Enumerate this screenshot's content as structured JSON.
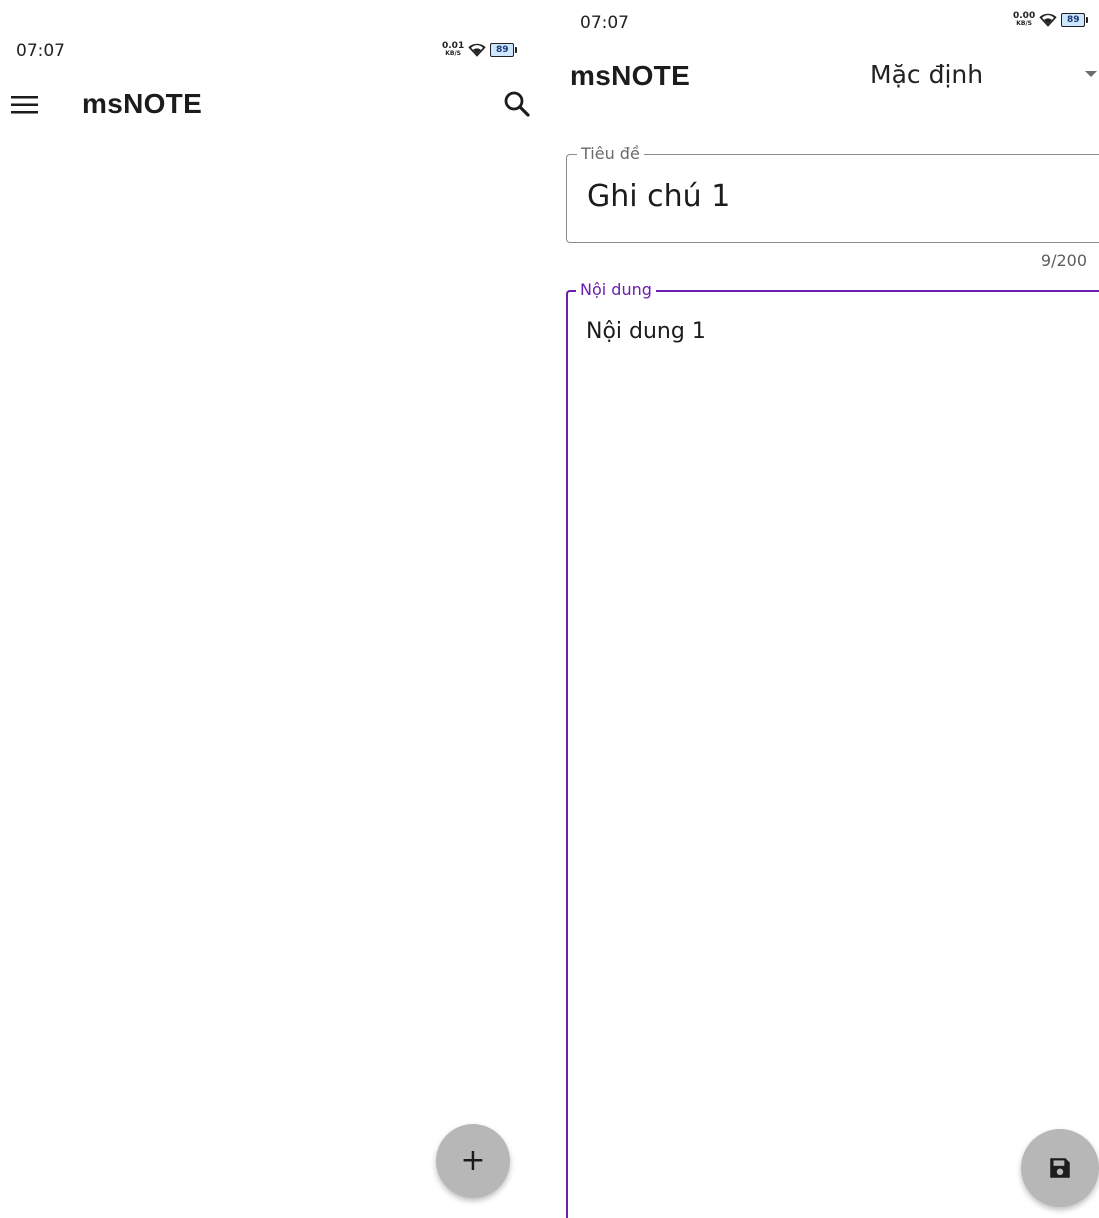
{
  "list_screen": {
    "status_bar": {
      "time": "07:07",
      "net_speed_value": "0.01",
      "net_speed_unit": "KB/S",
      "battery_level": "89"
    },
    "app_bar": {
      "title": "msNOTE",
      "menu_icon": "menu-icon",
      "search_icon": "search-icon"
    },
    "fab": {
      "label": "+",
      "icon": "add-icon",
      "color": "#b7b7b7"
    }
  },
  "edit_screen": {
    "status_bar": {
      "time": "07:07",
      "net_speed_value": "0.00",
      "net_speed_unit": "KB/S",
      "battery_level": "89"
    },
    "app_bar": {
      "title": "msNOTE",
      "category_selected": "Mặc định",
      "dropdown_icon": "chevron-down-icon"
    },
    "title_field": {
      "label": "Tiêu đề",
      "value": "Ghi chú 1",
      "counter": "9/200"
    },
    "content_field": {
      "label": "Nội dung",
      "value": "Nội dung 1",
      "accent_color": "#6a1fb0"
    },
    "fab": {
      "icon": "save-icon",
      "color": "#b7b7b7"
    }
  }
}
